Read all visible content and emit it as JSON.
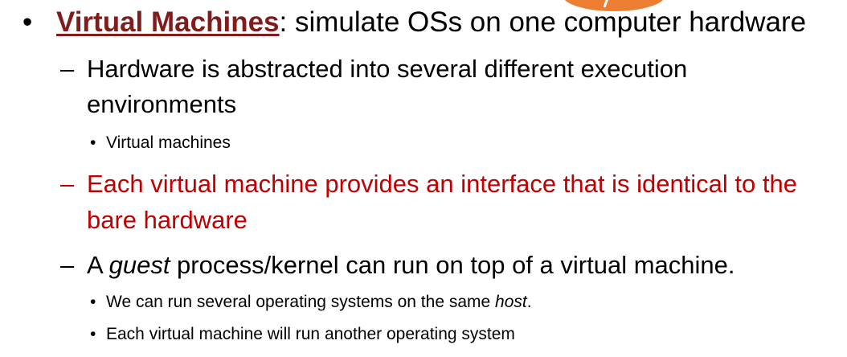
{
  "slide": {
    "decoration_color": "#ed7d31",
    "accent_title_color": "#7f1d1d",
    "accent_text_color": "#c00000",
    "items": [
      {
        "bullet": "•",
        "title": "Virtual Machines",
        "text": ": simulate OSs on one computer hardware"
      },
      {
        "bullet": "–",
        "text": "Hardware is abstracted into several different execution"
      },
      {
        "text": "environments"
      },
      {
        "bullet": "•",
        "text": "Virtual machines"
      },
      {
        "bullet": "–",
        "text": "Each virtual machine provides an interface that is identical to the"
      },
      {
        "text": "bare hardware"
      },
      {
        "bullet": "–",
        "text_a": "A ",
        "text_em": "guest",
        "text_b": " process/kernel can run on top of a virtual machine."
      },
      {
        "bullet": "•",
        "text_a": "We can run several operating systems on the same ",
        "text_em": "host",
        "text_b": "."
      },
      {
        "bullet": "•",
        "text": "Each virtual machine will run another operating system"
      }
    ]
  }
}
